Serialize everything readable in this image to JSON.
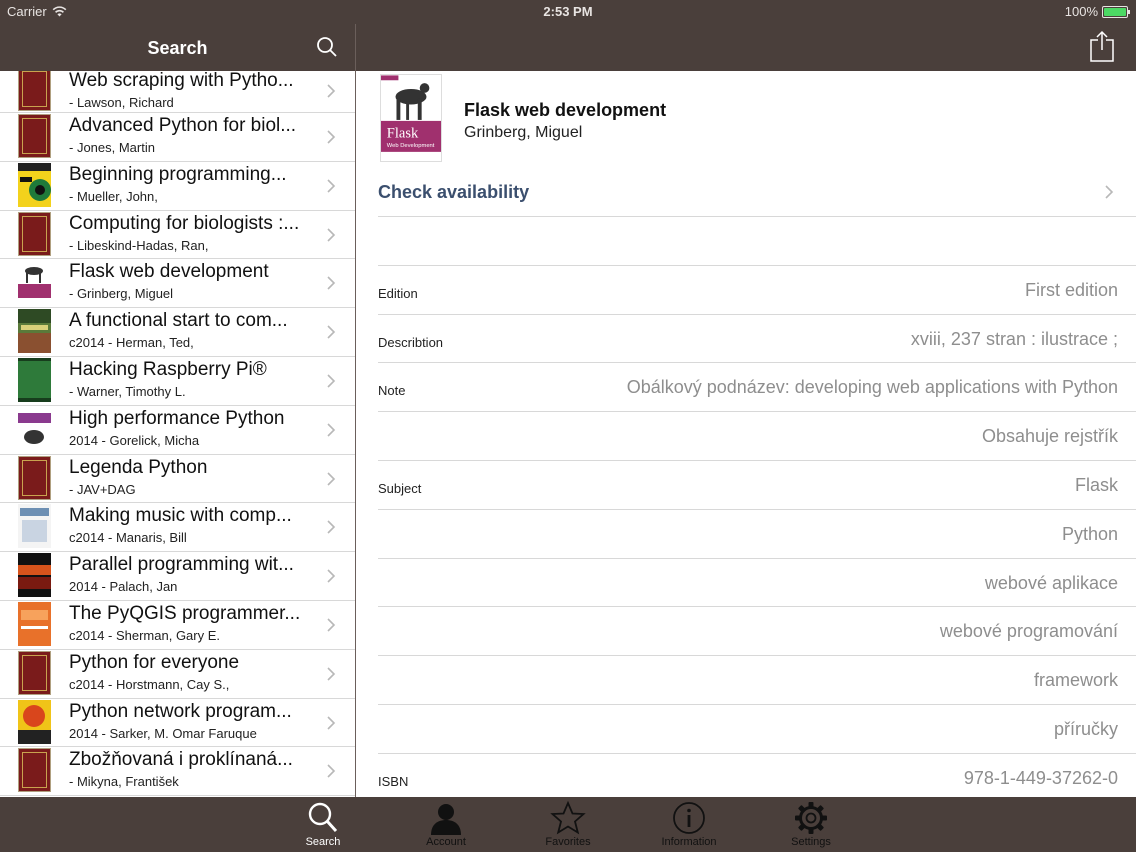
{
  "status": {
    "carrier": "Carrier",
    "time": "2:53 PM",
    "battery": "100%",
    "battery_level": 1.0
  },
  "nav": {
    "title": "Search"
  },
  "list": [
    {
      "title": "Web scraping with Pytho...",
      "subtitle": " - Lawson, Richard",
      "cover": "red"
    },
    {
      "title": "Advanced Python for biol...",
      "subtitle": " - Jones, Martin",
      "cover": "red"
    },
    {
      "title": "Beginning programming...",
      "subtitle": " - Mueller, John,",
      "cover": "dummies"
    },
    {
      "title": "Computing for biologists :...",
      "subtitle": " - Libeskind-Hadas, Ran,",
      "cover": "red"
    },
    {
      "title": "Flask web development",
      "subtitle": " - Grinberg, Miguel",
      "cover": "flask"
    },
    {
      "title": "A functional start to com...",
      "subtitle": "c2014 - Herman, Ted,",
      "cover": "python-green"
    },
    {
      "title": "Hacking Raspberry Pi®",
      "subtitle": " - Warner, Timothy L.",
      "cover": "raspberry"
    },
    {
      "title": "High performance Python",
      "subtitle": "2014 - Gorelick, Micha",
      "cover": "hpp"
    },
    {
      "title": "Legenda Python",
      "subtitle": " - JAV+DAG",
      "cover": "red"
    },
    {
      "title": "Making music with comp...",
      "subtitle": "c2014 - Manaris, Bill",
      "cover": "music"
    },
    {
      "title": "Parallel programming wit...",
      "subtitle": "2014 - Palach, Jan",
      "cover": "parallel"
    },
    {
      "title": "The PyQGIS programmer...",
      "subtitle": "c2014 - Sherman, Gary E.",
      "cover": "pyqgis"
    },
    {
      "title": "Python for everyone",
      "subtitle": "c2014 - Horstmann, Cay S.,",
      "cover": "red"
    },
    {
      "title": "Python network program...",
      "subtitle": "2014 - Sarker, M. Omar Faruque",
      "cover": "network"
    },
    {
      "title": "Zbožňovaná i proklínaná...",
      "subtitle": " - Mikyna, František",
      "cover": "red"
    }
  ],
  "detail": {
    "title": "Flask web development",
    "author": "Grinberg, Miguel",
    "cover_text": {
      "word": "Flask",
      "sub": "Web Development"
    },
    "availability_label": "Check availability",
    "fields": [
      {
        "label": "",
        "value": ""
      },
      {
        "label": "Edition",
        "value": "First edition"
      },
      {
        "label": "Describtion",
        "value": "xviii, 237 stran : ilustrace ;"
      },
      {
        "label": "Note",
        "value": "Obálkový podnázev: developing web applications with Python"
      },
      {
        "label": "",
        "value": "Obsahuje rejstřík"
      },
      {
        "label": "Subject",
        "value": "Flask"
      },
      {
        "label": "",
        "value": "Python"
      },
      {
        "label": "",
        "value": "webové aplikace"
      },
      {
        "label": "",
        "value": "webové programování"
      },
      {
        "label": "",
        "value": "framework"
      },
      {
        "label": "",
        "value": "příručky"
      },
      {
        "label": "ISBN",
        "value": "978-1-449-37262-0"
      }
    ]
  },
  "tabs": [
    {
      "label": "Search",
      "icon": "search-icon",
      "active": true
    },
    {
      "label": "Account",
      "icon": "person-icon",
      "active": false
    },
    {
      "label": "Favorites",
      "icon": "star-icon",
      "active": false
    },
    {
      "label": "Information",
      "icon": "info-icon",
      "active": false
    },
    {
      "label": "Settings",
      "icon": "gear-icon",
      "active": false
    }
  ],
  "colors": {
    "chrome": "#4a3f3b",
    "link": "#3b4f6e",
    "value": "#8e8e8e",
    "active_tab": "#ffffff"
  }
}
